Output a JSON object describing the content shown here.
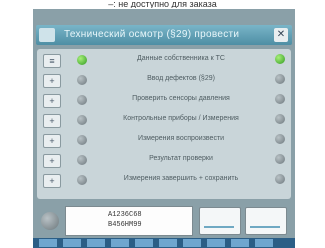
{
  "caption": "–: не доступно для заказа",
  "window": {
    "title": "Технический осмотр (§29) провести",
    "close_label": "✕"
  },
  "steps": [
    {
      "label": "Данные собственника к ТС",
      "status_left": "ok",
      "status_right": "ok"
    },
    {
      "label": "Ввод дефектов (§29)",
      "status_left": "gray",
      "status_right": "gray"
    },
    {
      "label": "Проверить сенсоры давления",
      "status_left": "gray",
      "status_right": "gray"
    },
    {
      "label": "Контрольные приборы / Измерения",
      "status_left": "gray",
      "status_right": "gray"
    },
    {
      "label": "Измерения воспроизвести",
      "status_left": "gray",
      "status_right": "gray"
    },
    {
      "label": "Результат проверки",
      "status_left": "gray",
      "status_right": "gray"
    },
    {
      "label": "Измерения завершить + сохранить",
      "status_left": "gray",
      "status_right": "gray"
    }
  ],
  "side_buttons": [
    "≡",
    "+",
    "+",
    "+",
    "+",
    "+",
    "+"
  ],
  "vehicle": {
    "id_line1": "A1236C68",
    "id_line2": "B456HM99"
  }
}
